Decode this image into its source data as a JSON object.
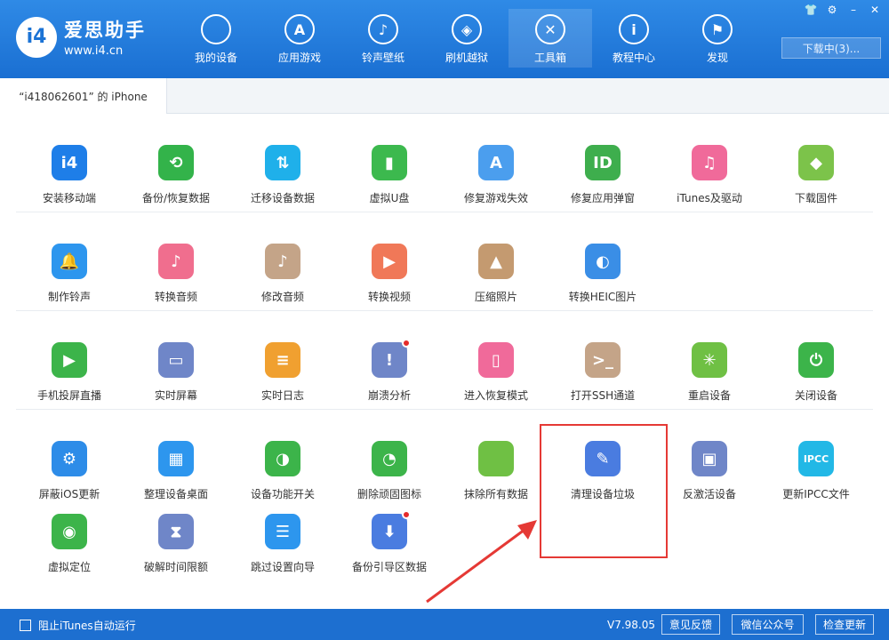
{
  "app": {
    "brand_name": "爱思助手",
    "brand_url": "www.i4.cn",
    "logo_glyph": "i4"
  },
  "nav": [
    {
      "label": "我的设备",
      "icon": "apple-icon",
      "glyph": ""
    },
    {
      "label": "应用游戏",
      "icon": "appstore-icon",
      "glyph": "A"
    },
    {
      "label": "铃声壁纸",
      "icon": "ringtone-icon",
      "glyph": "♪"
    },
    {
      "label": "刷机越狱",
      "icon": "dropbox-icon",
      "glyph": "◈"
    },
    {
      "label": "工具箱",
      "icon": "tools-icon",
      "glyph": "✕",
      "active": true
    },
    {
      "label": "教程中心",
      "icon": "info-icon",
      "glyph": "i"
    },
    {
      "label": "发现",
      "icon": "flag-icon",
      "glyph": "⚑"
    }
  ],
  "window_controls": [
    "👕",
    "⚙",
    "–",
    "✕"
  ],
  "download_label": "下载中(3)...",
  "device_tab": "“i418062601” 的 iPhone",
  "tools_rows": [
    [
      {
        "label": "安装移动端",
        "icon": "i4-icon",
        "glyph": "i4",
        "color": "#1e7ee8"
      },
      {
        "label": "备份/恢复数据",
        "icon": "backup-icon",
        "glyph": "⟲",
        "color": "#33b34a"
      },
      {
        "label": "迁移设备数据",
        "icon": "migrate-icon",
        "glyph": "⇅",
        "color": "#1fb0ea"
      },
      {
        "label": "虚拟U盘",
        "icon": "usb-icon",
        "glyph": "▮",
        "color": "#3cb94e"
      },
      {
        "label": "修复游戏失效",
        "icon": "appstore-repair-icon",
        "glyph": "A",
        "color": "#4b9eee"
      },
      {
        "label": "修复应用弹窗",
        "icon": "appleid-icon",
        "glyph": "ID",
        "color": "#3eae4d"
      },
      {
        "label": "iTunes及驱动",
        "icon": "itunes-icon",
        "glyph": "♫",
        "color": "#f06a9a"
      },
      {
        "label": "下载固件",
        "icon": "box-icon",
        "glyph": "◆",
        "color": "#7cc34a"
      }
    ],
    [
      {
        "label": "制作铃声",
        "icon": "bell-icon",
        "glyph": "🔔",
        "color": "#2d96ee"
      },
      {
        "label": "转换音频",
        "icon": "music-icon",
        "glyph": "♪",
        "color": "#f06e8e"
      },
      {
        "label": "修改音频",
        "icon": "music-edit-icon",
        "glyph": "♪",
        "color": "#c4a488"
      },
      {
        "label": "转换视频",
        "icon": "video-icon",
        "glyph": "▶",
        "color": "#f07858"
      },
      {
        "label": "压缩照片",
        "icon": "photo-icon",
        "glyph": "▲",
        "color": "#c49a70"
      },
      {
        "label": "转换HEIC图片",
        "icon": "heic-icon",
        "glyph": "◐",
        "color": "#3a8ee6"
      }
    ],
    [
      {
        "label": "手机投屏直播",
        "icon": "mirror-icon",
        "glyph": "▶",
        "color": "#3cb44a"
      },
      {
        "label": "实时屏幕",
        "icon": "screen-icon",
        "glyph": "▭",
        "color": "#6f86c8"
      },
      {
        "label": "实时日志",
        "icon": "log-icon",
        "glyph": "≡",
        "color": "#f0a030"
      },
      {
        "label": "崩溃分析",
        "icon": "crash-icon",
        "glyph": "!",
        "color": "#6f86c8",
        "dot": true
      },
      {
        "label": "进入恢复模式",
        "icon": "recovery-icon",
        "glyph": "▯",
        "color": "#f06a9a"
      },
      {
        "label": "打开SSH通道",
        "icon": "ssh-icon",
        "glyph": ">_",
        "color": "#c4a488"
      },
      {
        "label": "重启设备",
        "icon": "restart-icon",
        "glyph": "✳",
        "color": "#6fc044"
      },
      {
        "label": "关闭设备",
        "icon": "power-icon",
        "glyph": "⏻",
        "color": "#3cb44a"
      }
    ],
    [
      {
        "label": "屏蔽iOS更新",
        "icon": "block-update-icon",
        "glyph": "⚙",
        "color": "#2d8ce8"
      },
      {
        "label": "整理设备桌面",
        "icon": "desktop-icon",
        "glyph": "▦",
        "color": "#2d96ee"
      },
      {
        "label": "设备功能开关",
        "icon": "switch-icon",
        "glyph": "◑",
        "color": "#3cb44a"
      },
      {
        "label": "删除顽固图标",
        "icon": "pie-icon",
        "glyph": "◔",
        "color": "#3cb44a"
      },
      {
        "label": "抹除所有数据",
        "icon": "erase-icon",
        "glyph": "",
        "color": "#6fc044"
      },
      {
        "label": "清理设备垃圾",
        "icon": "broom-icon",
        "glyph": "✎",
        "color": "#4a7ce0"
      },
      {
        "label": "反激活设备",
        "icon": "deactivate-icon",
        "glyph": "▣",
        "color": "#6f86c8"
      },
      {
        "label": "更新IPCC文件",
        "icon": "ipcc-icon",
        "glyph": "IPCC",
        "color": "#22b8e6"
      }
    ],
    [
      {
        "label": "虚拟定位",
        "icon": "location-icon",
        "glyph": "◉",
        "color": "#3cb44a"
      },
      {
        "label": "破解时间限额",
        "icon": "hourglass-icon",
        "glyph": "⧗",
        "color": "#6f86c8"
      },
      {
        "label": "跳过设置向导",
        "icon": "skip-icon",
        "glyph": "☰",
        "color": "#2d96ee"
      },
      {
        "label": "备份引导区数据",
        "icon": "boot-backup-icon",
        "glyph": "⬇",
        "color": "#4a7ce0",
        "dot": true
      }
    ]
  ],
  "footer": {
    "itunes_autorun": "阻止iTunes自动运行",
    "version": "V7.98.05",
    "feedback": "意见反馈",
    "wechat": "微信公众号",
    "check_update": "检查更新"
  }
}
